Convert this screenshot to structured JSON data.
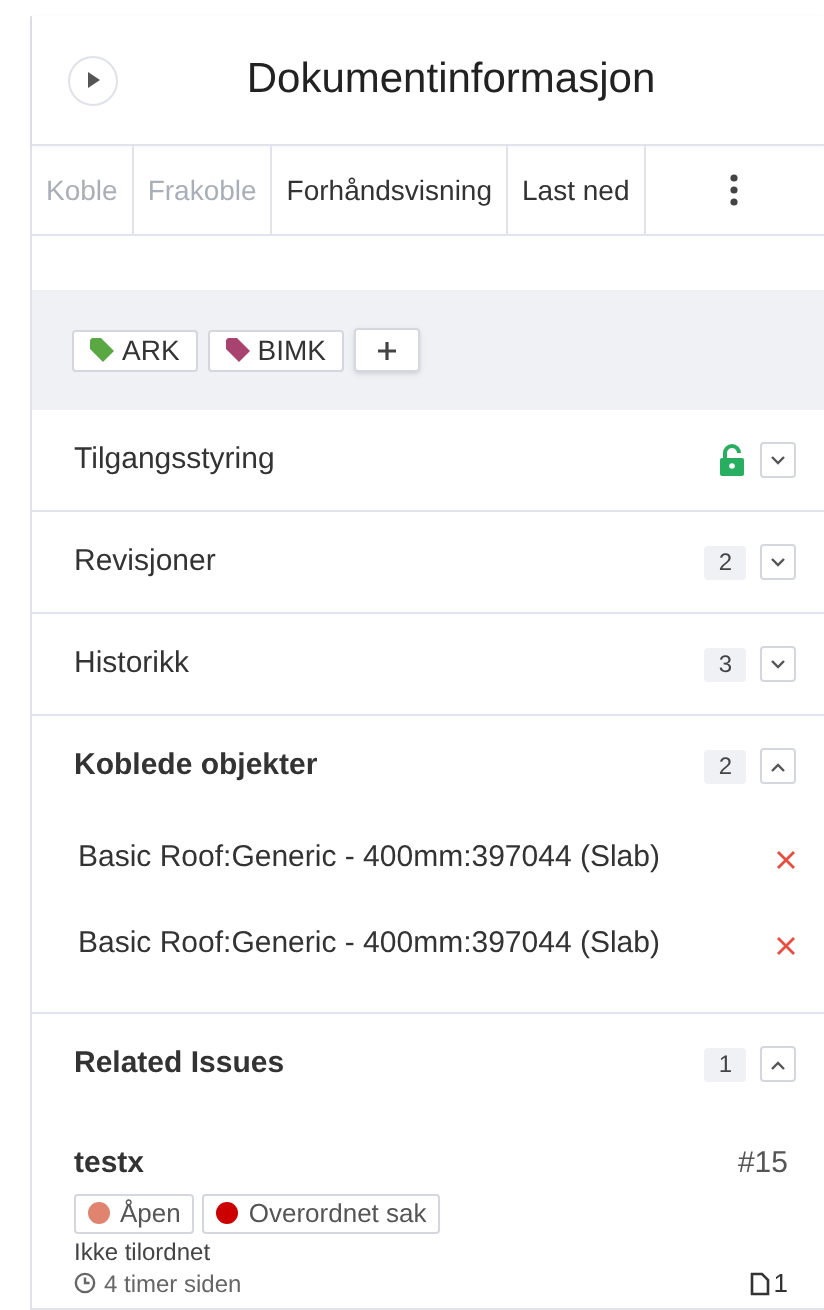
{
  "header": {
    "title": "Dokumentinformasjon"
  },
  "toolbar": [
    {
      "label": "Koble",
      "disabled": true
    },
    {
      "label": "Frakoble",
      "disabled": true
    },
    {
      "label": "Forhåndsvisning",
      "disabled": false
    },
    {
      "label": "Last ned",
      "disabled": false
    }
  ],
  "tags": [
    {
      "label": "ARK",
      "color": "#5aa843"
    },
    {
      "label": "BIMK",
      "color": "#a8426e"
    }
  ],
  "sections": [
    {
      "kind": "access",
      "title": "Tilgangsstyring",
      "locked": false,
      "expanded": false
    },
    {
      "kind": "count",
      "title": "Revisjoner",
      "count": "2",
      "expanded": false
    },
    {
      "kind": "count",
      "title": "Historikk",
      "count": "3",
      "expanded": false
    },
    {
      "kind": "objects",
      "title": "Koblede objekter",
      "count": "2",
      "expanded": true,
      "items": [
        "Basic Roof:Generic - 400mm:397044 (Slab)",
        "Basic Roof:Generic - 400mm:397044 (Slab)"
      ]
    },
    {
      "kind": "issues",
      "title": "Related Issues",
      "count": "1",
      "expanded": true,
      "issues": [
        {
          "title": "testx",
          "number": "#15",
          "labels": [
            {
              "label": "Åpen",
              "color": "#e08470"
            },
            {
              "label": "Overordnet sak",
              "color": "#cc0000"
            }
          ],
          "assignee": "Ikke tilordnet",
          "time": "4 timer siden",
          "attachments": "1"
        }
      ]
    }
  ]
}
